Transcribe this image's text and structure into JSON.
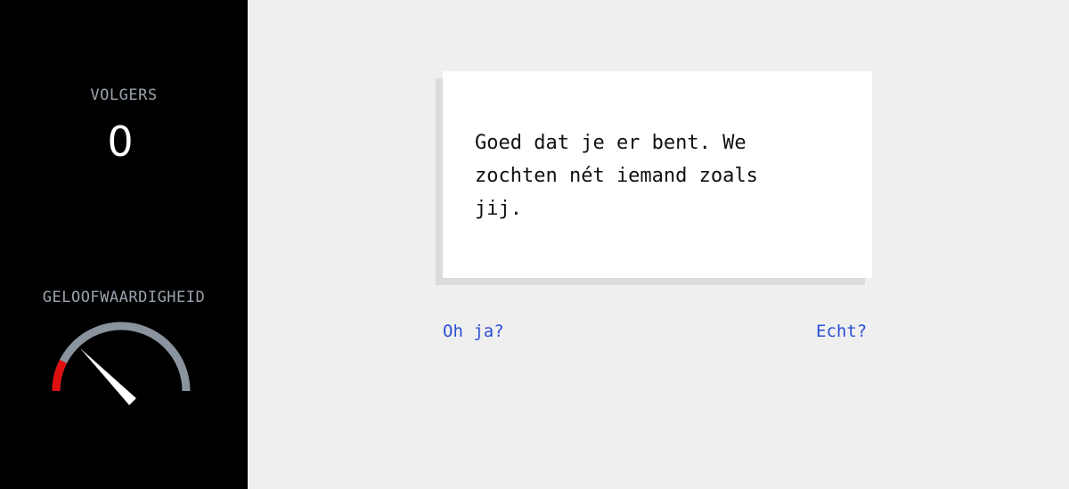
{
  "sidebar": {
    "followers_label": "VOLGERS",
    "followers_count": "0",
    "credibility_label": "GELOOFWAARDIGHEID",
    "credibility_level": 0.15
  },
  "dialog": {
    "message": "Goed dat je er bent. We zochten nét iemand zoals jij."
  },
  "choices": {
    "left": "Oh ja?",
    "right": "Echt?"
  },
  "colors": {
    "gauge_track": "#8a949e",
    "gauge_fill": "#e01010",
    "needle": "#ffffff",
    "link": "#2b4fd6"
  }
}
